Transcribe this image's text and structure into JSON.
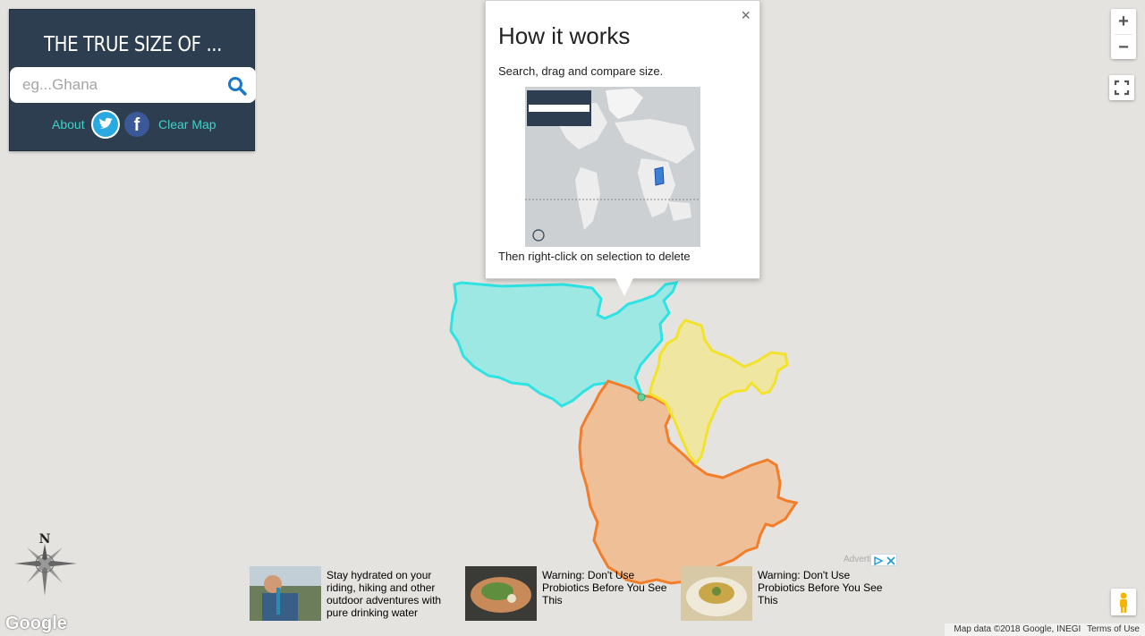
{
  "panel": {
    "title": "THE TRUE SIZE OF ...",
    "search_placeholder": "eg...Ghana",
    "about_label": "About",
    "facebook_glyph": "f",
    "clear_label": "Clear Map"
  },
  "popup": {
    "close_glyph": "×",
    "title": "How it works",
    "subtitle": "Search, drag and compare size.",
    "footer": "Then right-click on selection to delete"
  },
  "controls": {
    "zoom_in": "+",
    "zoom_out": "−",
    "compass_label": "N"
  },
  "footer": {
    "google": "Google",
    "map_data": "Map data ©2018 Google, INEGI",
    "terms": "Terms of Use"
  },
  "ads": {
    "label": "Advertisement",
    "items": [
      {
        "text": "Stay hydrated on your riding, hiking and other outdoor adventures with pure drinking water",
        "icon": "hydration-photo"
      },
      {
        "text": "Warning: Don't Use Probiotics Before You See This",
        "icon": "food-photo"
      },
      {
        "text": "Warning: Don't Use Probiotics Before You See This",
        "icon": "soup-photo"
      }
    ]
  },
  "shapes": [
    {
      "name": "united-states",
      "fill": "#9ee8e4",
      "stroke": "#2de3e3"
    },
    {
      "name": "india",
      "fill": "#f0e79b",
      "stroke": "#f3e22a"
    },
    {
      "name": "china",
      "fill": "#efbf98",
      "stroke": "#f07e2a"
    }
  ],
  "colors": {
    "panel_bg": "#2c3e50",
    "accent_link": "#40d1c8",
    "search_icon": "#1a77c9",
    "map_bg": "#e5e3df"
  }
}
